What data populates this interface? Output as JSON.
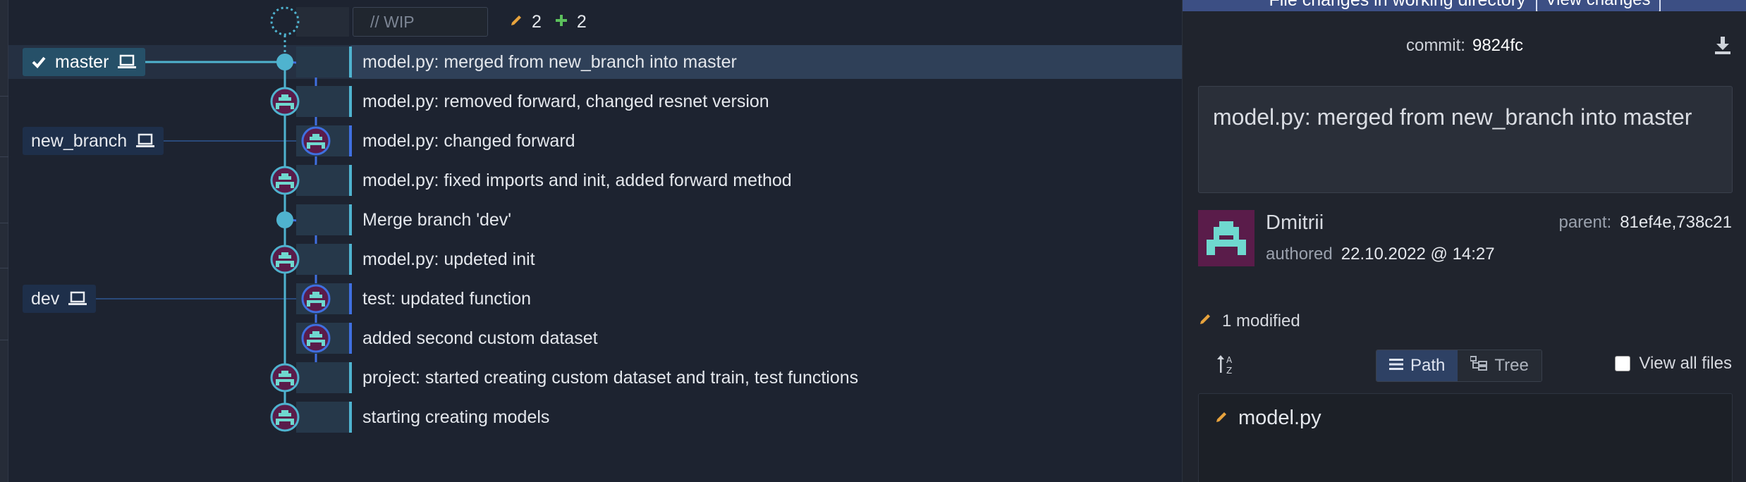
{
  "wip": {
    "placeholder": "// WIP",
    "modified_count": "2",
    "added_count": "2"
  },
  "branches": [
    {
      "name": "master",
      "active": true
    },
    {
      "name": "new_branch",
      "active": false
    },
    {
      "name": "dev",
      "active": false
    }
  ],
  "commits": [
    {
      "message": "model.py: merged from new_branch into master"
    },
    {
      "message": "model.py: removed forward, changed resnet version"
    },
    {
      "message": "model.py: changed forward"
    },
    {
      "message": "model.py: fixed imports and init, added forward method"
    },
    {
      "message": "Merge branch 'dev'"
    },
    {
      "message": "model.py: updeted init"
    },
    {
      "message": "test: updated function"
    },
    {
      "message": "added second custom dataset"
    },
    {
      "message": "project: started creating custom dataset and train, test functions"
    },
    {
      "message": "starting creating models"
    }
  ],
  "panel": {
    "banner_text": "File changes in working directory",
    "banner_button": "View changes",
    "commit_label": "commit:",
    "commit_sha": "9824fc",
    "message": "model.py: merged from new_branch into master",
    "author": "Dmitrii",
    "authored_label": "authored",
    "authored_date": "22.10.2022 @ 14:27",
    "parent_label": "parent:",
    "parent_value": "81ef4e,738c21",
    "modified_summary": "1 modified",
    "view_path": "Path",
    "view_tree": "Tree",
    "view_all_files": "View all files",
    "files": [
      {
        "name": "model.py",
        "status": "modified"
      }
    ]
  },
  "colors": {
    "graph_line_cyan": "#4fb3cf",
    "graph_line_blue": "#3f6fe0",
    "modified_orange": "#e8a33d",
    "added_green": "#5cc05c",
    "avatar_bg": "#5a1c4a",
    "avatar_fg": "#6fd8cf"
  },
  "icons": [
    "check-icon",
    "laptop-icon",
    "pencil-icon",
    "plus-icon",
    "download-icon",
    "sort-icon",
    "list-icon",
    "tree-icon"
  ]
}
